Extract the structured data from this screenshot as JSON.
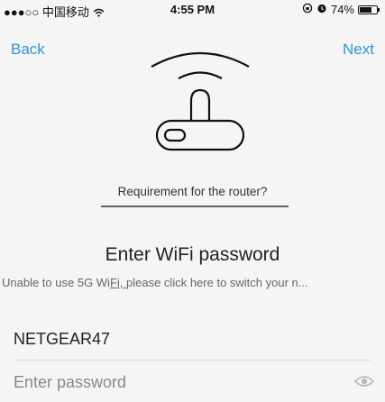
{
  "status_bar": {
    "signal": "●●●○○",
    "carrier": "中国移动",
    "wifi_icon": "wifi-icon",
    "time": "4:55 PM",
    "orientation_lock_icon": "orientation-lock-icon",
    "alarm_icon": "alarm-icon",
    "battery_percent": "74%",
    "battery_level": 0.74
  },
  "nav": {
    "back_label": "Back",
    "next_label": "Next",
    "accent_color": "#2a98d6"
  },
  "hero": {
    "icon": "router-wifi-icon"
  },
  "requirement_link": "Requirement for the router?",
  "title": "Enter WiFi password",
  "note": {
    "prefix": "Unable to use 5G Wi",
    "link": "Fi, ",
    "suffix": "please click here to switch your n..."
  },
  "form": {
    "ssid": "NETGEAR47",
    "password_value": "",
    "password_placeholder": "Enter password",
    "show_password_icon": "eye-icon"
  }
}
